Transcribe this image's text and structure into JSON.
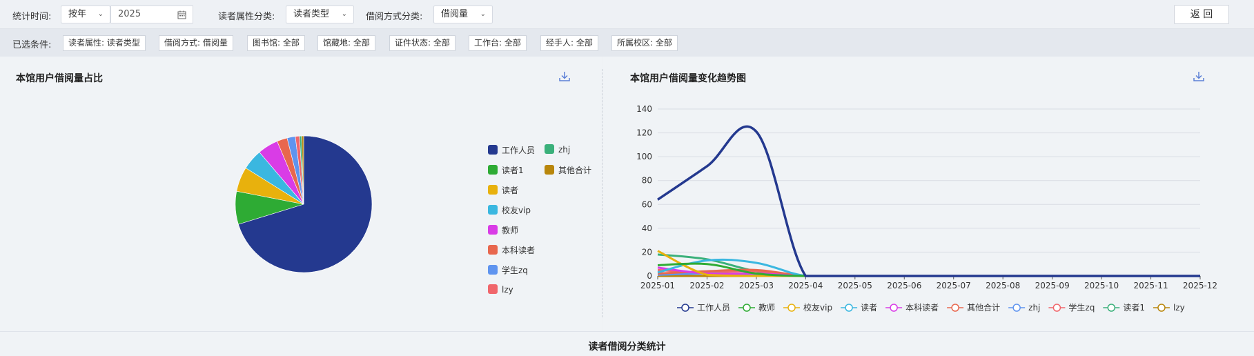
{
  "filters": {
    "time_label": "统计时间:",
    "time_mode": "按年",
    "year": "2025",
    "reader_attr_label": "读者属性分类:",
    "reader_attr_value": "读者类型",
    "borrow_mode_label": "借阅方式分类:",
    "borrow_mode_value": "借阅量",
    "back_button": "返 回"
  },
  "conditions": {
    "label": "已选条件:",
    "tags": [
      "读者属性: 读者类型",
      "借阅方式: 借阅量",
      "图书馆: 全部",
      "馆藏地: 全部",
      "证件状态: 全部",
      "工作台: 全部",
      "经手人: 全部",
      "所属校区: 全部"
    ]
  },
  "pie_panel": {
    "title": "本馆用户借阅量占比"
  },
  "line_panel": {
    "title": "本馆用户借阅量变化趋势图"
  },
  "bottom": {
    "title": "读者借阅分类统计"
  },
  "icons": {
    "download": "download-icon",
    "calendar": "calendar-icon",
    "dropdown": "chevron-down-icon"
  },
  "chart_data": [
    {
      "type": "pie",
      "title": "本馆用户借阅量占比",
      "legend": "right",
      "slices": [
        {
          "name": "工作人员",
          "value": 72,
          "color": "#24398f"
        },
        {
          "name": "读者1",
          "value": 8,
          "color": "#2eab34"
        },
        {
          "name": "读者",
          "value": 6,
          "color": "#e8b10d"
        },
        {
          "name": "校友vip",
          "value": 5,
          "color": "#3ab7e0"
        },
        {
          "name": "教师",
          "value": 5,
          "color": "#d93ce6"
        },
        {
          "name": "本科读者",
          "value": 2.5,
          "color": "#e8674e"
        },
        {
          "name": "学生zq",
          "value": 2,
          "color": "#5f94ef"
        },
        {
          "name": "lzy",
          "value": 1,
          "color": "#f0666b"
        },
        {
          "name": "zhj",
          "value": 0.5,
          "color": "#3ab07a"
        },
        {
          "name": "其他合计",
          "value": 0.5,
          "color": "#b8860b"
        }
      ]
    },
    {
      "type": "line",
      "title": "本馆用户借阅量变化趋势图",
      "legend": "bottom",
      "grid": true,
      "x": [
        "2025-01",
        "2025-02",
        "2025-03",
        "2025-04",
        "2025-05",
        "2025-06",
        "2025-07",
        "2025-08",
        "2025-09",
        "2025-10",
        "2025-11",
        "2025-12"
      ],
      "ylim": [
        0,
        140
      ],
      "yticks": [
        0,
        20,
        40,
        60,
        80,
        100,
        120,
        140
      ],
      "series": [
        {
          "name": "工作人员",
          "color": "#24398f",
          "values": [
            64,
            92,
            121,
            0,
            0,
            0,
            0,
            0,
            0,
            0,
            0,
            0
          ]
        },
        {
          "name": "教师",
          "color": "#2eab34",
          "values": [
            9,
            10,
            2,
            0,
            0,
            0,
            0,
            0,
            0,
            0,
            0,
            0
          ]
        },
        {
          "name": "校友vip",
          "color": "#e8b10d",
          "values": [
            21,
            1,
            0,
            0,
            0,
            0,
            0,
            0,
            0,
            0,
            0,
            0
          ]
        },
        {
          "name": "读者",
          "color": "#3ab7e0",
          "values": [
            3,
            13,
            11,
            0,
            0,
            0,
            0,
            0,
            0,
            0,
            0,
            0
          ]
        },
        {
          "name": "本科读者",
          "color": "#d93ce6",
          "values": [
            7,
            2,
            2,
            0,
            0,
            0,
            0,
            0,
            0,
            0,
            0,
            0
          ]
        },
        {
          "name": "其他合计",
          "color": "#e8674e",
          "values": [
            2,
            4,
            5,
            0,
            0,
            0,
            0,
            0,
            0,
            0,
            0,
            0
          ]
        },
        {
          "name": "zhj",
          "color": "#5f94ef",
          "values": [
            1,
            2,
            1,
            0,
            0,
            0,
            0,
            0,
            0,
            0,
            0,
            0
          ]
        },
        {
          "name": "学生zq",
          "color": "#f0666b",
          "values": [
            5,
            3,
            4,
            0,
            0,
            0,
            0,
            0,
            0,
            0,
            0,
            0
          ]
        },
        {
          "name": "读者1",
          "color": "#3ab07a",
          "values": [
            18,
            14,
            4,
            0,
            0,
            0,
            0,
            0,
            0,
            0,
            0,
            0
          ]
        },
        {
          "name": "lzy",
          "color": "#b8860b",
          "values": [
            0,
            0,
            0,
            0,
            0,
            0,
            0,
            0,
            0,
            0,
            0,
            0
          ]
        }
      ]
    }
  ]
}
